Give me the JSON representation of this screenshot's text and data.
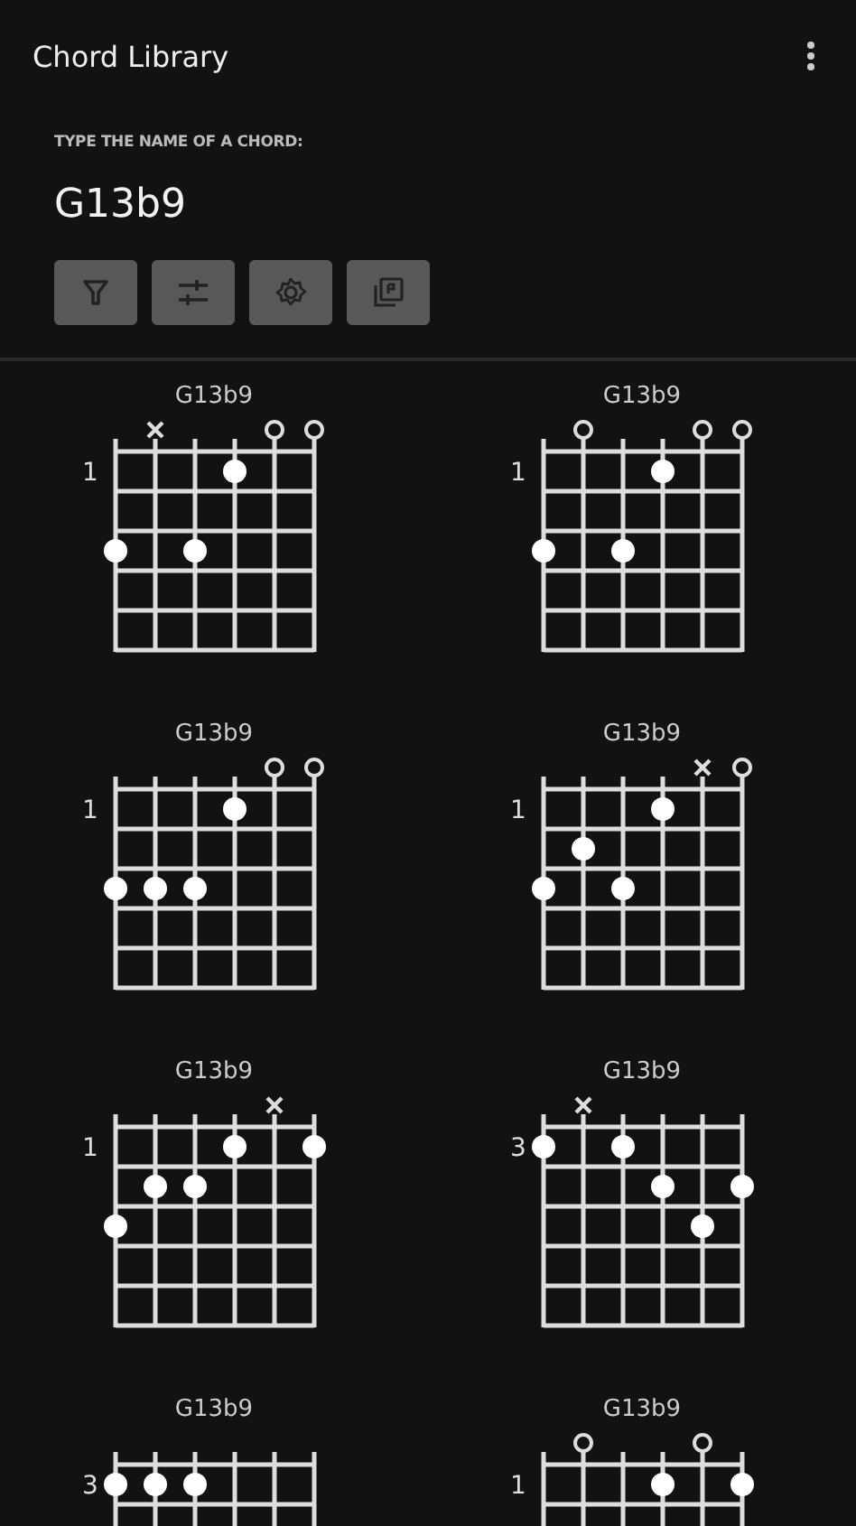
{
  "app_bar": {
    "title": "Chord Library"
  },
  "search": {
    "label": "TYPE THE NAME OF A CHORD:",
    "value": "G13b9"
  },
  "toolbar": [
    {
      "kind": "filter"
    },
    {
      "kind": "sliders"
    },
    {
      "kind": "settings"
    },
    {
      "kind": "library"
    }
  ],
  "chords": [
    {
      "name": "G13b9",
      "base_fret": "1",
      "strings": [
        {
          "kind": "fret3"
        },
        {
          "kind": "muted"
        },
        {
          "kind": "fret3"
        },
        {
          "kind": "fret1"
        },
        {
          "kind": "open"
        },
        {
          "kind": "open"
        }
      ]
    },
    {
      "name": "G13b9",
      "base_fret": "1",
      "strings": [
        {
          "kind": "fret3"
        },
        {
          "kind": "open"
        },
        {
          "kind": "fret3"
        },
        {
          "kind": "fret1"
        },
        {
          "kind": "open"
        },
        {
          "kind": "open"
        }
      ]
    },
    {
      "name": "G13b9",
      "base_fret": "1",
      "strings": [
        {
          "kind": "fret3"
        },
        {
          "kind": "fret3"
        },
        {
          "kind": "fret3"
        },
        {
          "kind": "fret1"
        },
        {
          "kind": "open"
        },
        {
          "kind": "open"
        }
      ]
    },
    {
      "name": "G13b9",
      "base_fret": "1",
      "strings": [
        {
          "kind": "fret3"
        },
        {
          "kind": "fret2"
        },
        {
          "kind": "fret3"
        },
        {
          "kind": "fret1"
        },
        {
          "kind": "muted"
        },
        {
          "kind": "open"
        }
      ]
    },
    {
      "name": "G13b9",
      "base_fret": "1",
      "strings": [
        {
          "kind": "fret3"
        },
        {
          "kind": "fret2"
        },
        {
          "kind": "fret2"
        },
        {
          "kind": "fret1"
        },
        {
          "kind": "muted"
        },
        {
          "kind": "fret1"
        }
      ]
    },
    {
      "name": "G13b9",
      "base_fret": "3",
      "strings": [
        {
          "kind": "fret1"
        },
        {
          "kind": "muted"
        },
        {
          "kind": "fret1"
        },
        {
          "kind": "fret2"
        },
        {
          "kind": "fret3"
        },
        {
          "kind": "fret2"
        }
      ]
    },
    {
      "name": "G13b9",
      "base_fret": "3",
      "strings": [
        {
          "kind": "fret1"
        },
        {
          "kind": "fret1"
        },
        {
          "kind": "fret1"
        },
        {
          "kind": "none"
        },
        {
          "kind": "none"
        },
        {
          "kind": "none"
        }
      ]
    },
    {
      "name": "G13b9",
      "base_fret": "1",
      "strings": [
        {
          "kind": "none"
        },
        {
          "kind": "open"
        },
        {
          "kind": "none"
        },
        {
          "kind": "fret1"
        },
        {
          "kind": "open"
        },
        {
          "kind": "fret1"
        }
      ]
    }
  ]
}
